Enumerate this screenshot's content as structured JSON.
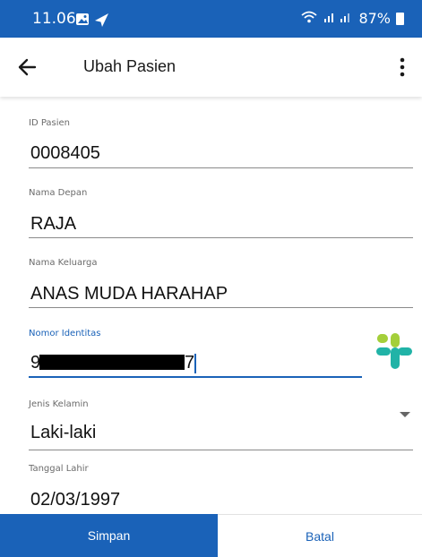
{
  "status_bar": {
    "time": "11.06",
    "battery": "87%",
    "icons": [
      "gallery-icon",
      "navigation-icon",
      "wifi-icon",
      "signal-icon",
      "battery-icon"
    ]
  },
  "app_bar": {
    "title": "Ubah Pasien",
    "back_icon": "arrow-left-icon",
    "menu_icon": "more-vertical-icon"
  },
  "form": {
    "patient_id": {
      "label": "ID Pasien",
      "value": "0008405"
    },
    "first_name": {
      "label": "Nama Depan",
      "value": "RAJA"
    },
    "family_name": {
      "label": "Nama Keluarga",
      "value": "ANAS MUDA HARAHAP"
    },
    "id_number": {
      "label": "Nomor Identitas",
      "value_start": "9",
      "value_end": "7",
      "redacted": true
    },
    "gender": {
      "label": "Jenis Kelamin",
      "value": "Laki-laki"
    },
    "birth_date": {
      "label": "Tanggal Lahir",
      "value": "02/03/1997"
    }
  },
  "actions": {
    "save_label": "Simpan",
    "cancel_label": "Batal"
  },
  "colors": {
    "primary": "#1a62b8",
    "logo_green": "#a4cf3a",
    "logo_teal": "#21b3a7"
  }
}
